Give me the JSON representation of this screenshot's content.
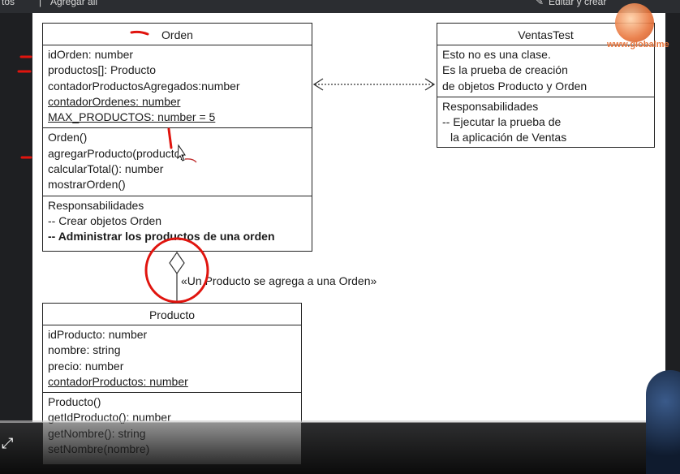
{
  "top_bar": {
    "left_tab": "tos",
    "middle_tab": "Agregar ali",
    "right_tab": "Editar y crear"
  },
  "brand": {
    "text": "www.globalme"
  },
  "diagram": {
    "orden": {
      "title": "Orden",
      "attributes": [
        {
          "text": "idOrden: number",
          "underline": false,
          "bold": false
        },
        {
          "text": "productos[]: Producto",
          "underline": false,
          "bold": false
        },
        {
          "text": "contadorProductosAgregados:number",
          "underline": false,
          "bold": false
        },
        {
          "text": "contadorOrdenes: number",
          "underline": true,
          "bold": false
        },
        {
          "text": "MAX_PRODUCTOS: number = 5",
          "underline": true,
          "bold": false
        }
      ],
      "methods": [
        {
          "text": "Orden()",
          "underline": false,
          "bold": false
        },
        {
          "text": "agregarProducto(producto)",
          "underline": false,
          "bold": false
        },
        {
          "text": "calcularTotal(): number",
          "underline": false,
          "bold": false
        },
        {
          "text": "mostrarOrden()",
          "underline": false,
          "bold": false
        }
      ],
      "responsibilities": [
        {
          "text": "Responsabilidades",
          "underline": false,
          "bold": false
        },
        {
          "text": "-- Crear objetos Orden",
          "underline": false,
          "bold": false
        },
        {
          "text": "-- Administrar los productos de una orden",
          "underline": false,
          "bold": true
        }
      ]
    },
    "ventas_test": {
      "title": "VentasTest",
      "description": [
        {
          "text": "Esto no es una clase.",
          "underline": false,
          "bold": false
        },
        {
          "text": "Es la prueba de creación",
          "underline": false,
          "bold": false
        },
        {
          "text": "de objetos Producto y Orden",
          "underline": false,
          "bold": false
        }
      ],
      "responsibilities": [
        {
          "text": "Responsabilidades",
          "underline": false,
          "bold": false
        },
        {
          "text": "-- Ejecutar la prueba de",
          "underline": false,
          "bold": false
        },
        {
          "text": "   la aplicación de Ventas",
          "underline": false,
          "bold": false
        }
      ]
    },
    "producto": {
      "title": "Producto",
      "attributes": [
        {
          "text": "idProducto: number",
          "underline": false,
          "bold": false
        },
        {
          "text": "nombre: string",
          "underline": false,
          "bold": false
        },
        {
          "text": "precio: number",
          "underline": false,
          "bold": false
        },
        {
          "text": "contadorProductos: number",
          "underline": true,
          "bold": false
        }
      ],
      "methods": [
        {
          "text": "Producto()",
          "underline": false,
          "bold": false
        },
        {
          "text": "getIdProducto(): number",
          "underline": false,
          "bold": false
        },
        {
          "text": "getNombre(): string",
          "underline": false,
          "bold": false
        },
        {
          "text": "setNombre(nombre)",
          "underline": false,
          "bold": false
        }
      ]
    },
    "aggregation_label": "«Un Producto se agrega a una Orden»"
  },
  "player": {
    "progress": 0.0,
    "accent_color": "#e62117"
  },
  "colors": {
    "annotation_red": "#e0140e",
    "canvas_bg": "#ffffff",
    "dark_bg": "#1e1f22"
  }
}
